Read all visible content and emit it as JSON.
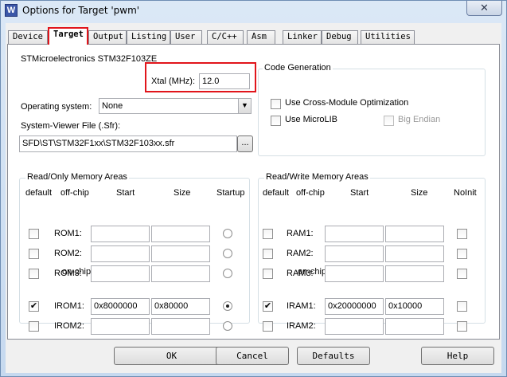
{
  "window": {
    "title": "Options for Target 'pwm'",
    "app_icon_glyph": "W",
    "close_glyph": "✕"
  },
  "tabs": [
    {
      "label": "Device"
    },
    {
      "label": "Target"
    },
    {
      "label": "Output"
    },
    {
      "label": "Listing"
    },
    {
      "label": "User"
    },
    {
      "label": "C/C++"
    },
    {
      "label": "Asm"
    },
    {
      "label": "Linker"
    },
    {
      "label": "Debug"
    },
    {
      "label": "Utilities"
    }
  ],
  "active_tab": "Target",
  "target": {
    "device_name": "STMicroelectronics STM32F103ZE",
    "xtal_label": "Xtal (MHz):",
    "xtal_value": "12.0",
    "os_label": "Operating system:",
    "os_value": "None",
    "svf_label": "System-Viewer File (.Sfr):",
    "svf_value": "SFD\\ST\\STM32F1xx\\STM32F103xx.sfr",
    "browse_label": "..."
  },
  "code_generation": {
    "title": "Code Generation",
    "cross_module_label": "Use Cross-Module Optimization",
    "cross_module_checked": false,
    "microlib_label": "Use MicroLIB",
    "microlib_checked": false,
    "big_endian_label": "Big Endian",
    "big_endian_checked": false,
    "big_endian_enabled": false
  },
  "ro_memory": {
    "title": "Read/Only Memory Areas",
    "headers": {
      "default": "default",
      "offchip": "off-chip",
      "start": "Start",
      "size": "Size",
      "startup": "Startup"
    },
    "onchip_label": "on-chip",
    "rows": [
      {
        "name": "ROM1:",
        "default": false,
        "start": "",
        "size": "",
        "startup": false
      },
      {
        "name": "ROM2:",
        "default": false,
        "start": "",
        "size": "",
        "startup": false
      },
      {
        "name": "ROM3:",
        "default": false,
        "start": "",
        "size": "",
        "startup": false
      },
      {
        "name": "IROM1:",
        "default": true,
        "start": "0x8000000",
        "size": "0x80000",
        "startup": true
      },
      {
        "name": "IROM2:",
        "default": false,
        "start": "",
        "size": "",
        "startup": false
      }
    ]
  },
  "rw_memory": {
    "title": "Read/Write Memory Areas",
    "headers": {
      "default": "default",
      "offchip": "off-chip",
      "start": "Start",
      "size": "Size",
      "noinit": "NoInit"
    },
    "onchip_label": "on-chip",
    "rows": [
      {
        "name": "RAM1:",
        "default": false,
        "start": "",
        "size": "",
        "noinit": false
      },
      {
        "name": "RAM2:",
        "default": false,
        "start": "",
        "size": "",
        "noinit": false
      },
      {
        "name": "RAM3:",
        "default": false,
        "start": "",
        "size": "",
        "noinit": false
      },
      {
        "name": "IRAM1:",
        "default": true,
        "start": "0x20000000",
        "size": "0x10000",
        "noinit": false
      },
      {
        "name": "IRAM2:",
        "default": false,
        "start": "",
        "size": "",
        "noinit": false
      }
    ]
  },
  "buttons": {
    "ok": "OK",
    "cancel": "Cancel",
    "defaults": "Defaults",
    "help": "Help"
  },
  "colors": {
    "highlight_red": "#e1151b",
    "title_bar": "#cfe0f3"
  }
}
